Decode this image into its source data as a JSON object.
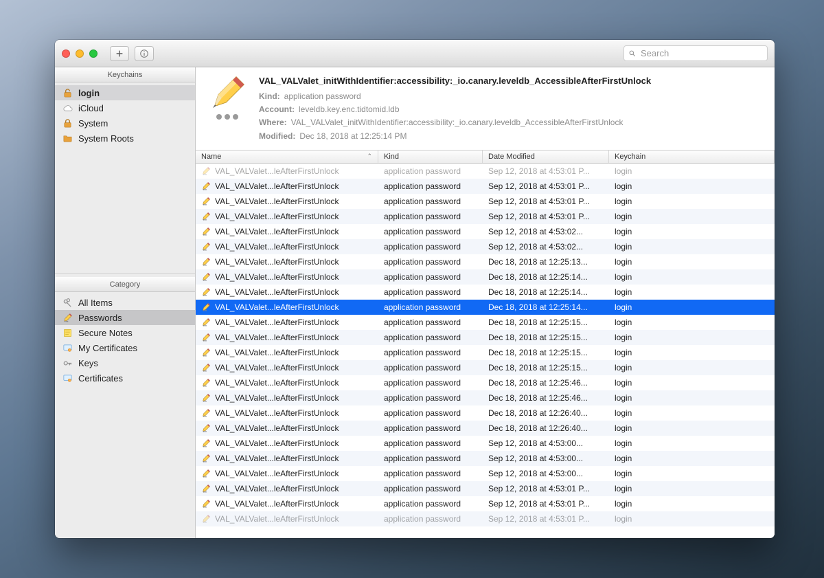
{
  "search": {
    "placeholder": "Search"
  },
  "sidebar": {
    "keychains_header": "Keychains",
    "category_header": "Category",
    "keychains": [
      {
        "label": "login",
        "icon": "lock-open",
        "selected": true
      },
      {
        "label": "iCloud",
        "icon": "cloud"
      },
      {
        "label": "System",
        "icon": "lock-closed"
      },
      {
        "label": "System Roots",
        "icon": "folder"
      }
    ],
    "categories": [
      {
        "label": "All Items",
        "icon": "keys-pair"
      },
      {
        "label": "Passwords",
        "icon": "pencil",
        "selected": true
      },
      {
        "label": "Secure Notes",
        "icon": "note"
      },
      {
        "label": "My Certificates",
        "icon": "certificate"
      },
      {
        "label": "Keys",
        "icon": "key"
      },
      {
        "label": "Certificates",
        "icon": "certificate"
      }
    ]
  },
  "detail": {
    "title": "VAL_VALValet_initWithIdentifier:accessibility:_io.canary.leveldb_AccessibleAfterFirstUnlock",
    "kind_label": "Kind:",
    "kind_value": "application password",
    "account_label": "Account:",
    "account_value": "leveldb.key.enc.tidtomid.ldb",
    "where_label": "Where:",
    "where_value": "VAL_VALValet_initWithIdentifier:accessibility:_io.canary.leveldb_AccessibleAfterFirstUnlock",
    "modified_label": "Modified:",
    "modified_value": "Dec 18, 2018 at 12:25:14 PM"
  },
  "columns": {
    "name": "Name",
    "kind": "Kind",
    "date": "Date Modified",
    "keychain": "Keychain"
  },
  "rows": [
    {
      "name": "VAL_VALValet...leAfterFirstUnlock",
      "kind": "application password",
      "date": "Sep 12, 2018 at 4:53:01 P...",
      "keychain": "login",
      "partial": true
    },
    {
      "name": "VAL_VALValet...leAfterFirstUnlock",
      "kind": "application password",
      "date": "Sep 12, 2018 at 4:53:01 P...",
      "keychain": "login"
    },
    {
      "name": "VAL_VALValet...leAfterFirstUnlock",
      "kind": "application password",
      "date": "Sep 12, 2018 at 4:53:01 P...",
      "keychain": "login"
    },
    {
      "name": "VAL_VALValet...leAfterFirstUnlock",
      "kind": "application password",
      "date": "Sep 12, 2018 at 4:53:01 P...",
      "keychain": "login"
    },
    {
      "name": "VAL_VALValet...leAfterFirstUnlock",
      "kind": "application password",
      "date": "Sep 12, 2018 at 4:53:02...",
      "keychain": "login"
    },
    {
      "name": "VAL_VALValet...leAfterFirstUnlock",
      "kind": "application password",
      "date": "Sep 12, 2018 at 4:53:02...",
      "keychain": "login"
    },
    {
      "name": "VAL_VALValet...leAfterFirstUnlock",
      "kind": "application password",
      "date": "Dec 18, 2018 at 12:25:13...",
      "keychain": "login"
    },
    {
      "name": "VAL_VALValet...leAfterFirstUnlock",
      "kind": "application password",
      "date": "Dec 18, 2018 at 12:25:14...",
      "keychain": "login"
    },
    {
      "name": "VAL_VALValet...leAfterFirstUnlock",
      "kind": "application password",
      "date": "Dec 18, 2018 at 12:25:14...",
      "keychain": "login"
    },
    {
      "name": "VAL_VALValet...leAfterFirstUnlock",
      "kind": "application password",
      "date": "Dec 18, 2018 at 12:25:14...",
      "keychain": "login",
      "selected": true
    },
    {
      "name": "VAL_VALValet...leAfterFirstUnlock",
      "kind": "application password",
      "date": "Dec 18, 2018 at 12:25:15...",
      "keychain": "login"
    },
    {
      "name": "VAL_VALValet...leAfterFirstUnlock",
      "kind": "application password",
      "date": "Dec 18, 2018 at 12:25:15...",
      "keychain": "login"
    },
    {
      "name": "VAL_VALValet...leAfterFirstUnlock",
      "kind": "application password",
      "date": "Dec 18, 2018 at 12:25:15...",
      "keychain": "login"
    },
    {
      "name": "VAL_VALValet...leAfterFirstUnlock",
      "kind": "application password",
      "date": "Dec 18, 2018 at 12:25:15...",
      "keychain": "login"
    },
    {
      "name": "VAL_VALValet...leAfterFirstUnlock",
      "kind": "application password",
      "date": "Dec 18, 2018 at 12:25:46...",
      "keychain": "login"
    },
    {
      "name": "VAL_VALValet...leAfterFirstUnlock",
      "kind": "application password",
      "date": "Dec 18, 2018 at 12:25:46...",
      "keychain": "login"
    },
    {
      "name": "VAL_VALValet...leAfterFirstUnlock",
      "kind": "application password",
      "date": "Dec 18, 2018 at 12:26:40...",
      "keychain": "login"
    },
    {
      "name": "VAL_VALValet...leAfterFirstUnlock",
      "kind": "application password",
      "date": "Dec 18, 2018 at 12:26:40...",
      "keychain": "login"
    },
    {
      "name": "VAL_VALValet...leAfterFirstUnlock",
      "kind": "application password",
      "date": "Sep 12, 2018 at 4:53:00...",
      "keychain": "login"
    },
    {
      "name": "VAL_VALValet...leAfterFirstUnlock",
      "kind": "application password",
      "date": "Sep 12, 2018 at 4:53:00...",
      "keychain": "login"
    },
    {
      "name": "VAL_VALValet...leAfterFirstUnlock",
      "kind": "application password",
      "date": "Sep 12, 2018 at 4:53:00...",
      "keychain": "login"
    },
    {
      "name": "VAL_VALValet...leAfterFirstUnlock",
      "kind": "application password",
      "date": "Sep 12, 2018 at 4:53:01 P...",
      "keychain": "login"
    },
    {
      "name": "VAL_VALValet...leAfterFirstUnlock",
      "kind": "application password",
      "date": "Sep 12, 2018 at 4:53:01 P...",
      "keychain": "login"
    },
    {
      "name": "VAL_VALValet...leAfterFirstUnlock",
      "kind": "application password",
      "date": "Sep 12, 2018 at 4:53:01 P...",
      "keychain": "login",
      "partial": true
    }
  ]
}
